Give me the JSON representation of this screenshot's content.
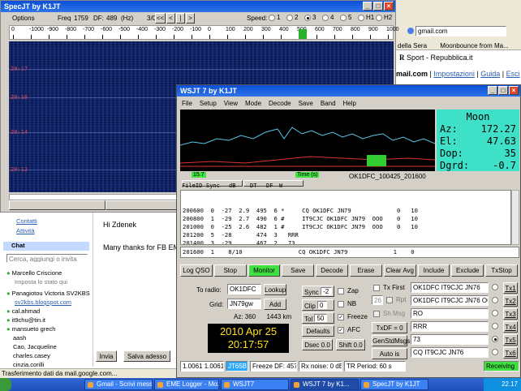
{
  "browser": {
    "toolbar_right": "gmail.com",
    "bookmarks": [
      "della Sera",
      "Moonbounce from Ma...",
      "Sport - Repubblica.it"
    ],
    "gmail_links": [
      "mail.com",
      "Impostazioni",
      "Guida",
      "Esci"
    ],
    "sidebar": {
      "contacts": "Contatti",
      "activity": "Attività",
      "chat_header": "Chat",
      "search_placeholder": "Cerca, aggiungi o invita",
      "contacts_list": [
        {
          "name": "Marcello Criscione",
          "status": "Imposta lo stato qui"
        },
        {
          "name": "Panagiotou Victoria SV2KBS",
          "status": "sv2kbs.blogspot.com"
        },
        {
          "name": "cal.ahmad"
        },
        {
          "name": "it9chu@tin.it"
        },
        {
          "name": "mansueto grech"
        },
        {
          "name": "aash"
        },
        {
          "name": "Cao, Jacqueline"
        },
        {
          "name": "charles.casey"
        },
        {
          "name": "cinzia.corilli"
        }
      ]
    },
    "mail": {
      "greeting": "Hi Zdenek",
      "body": "Many thanks for FB EME QSO",
      "send": "Invia",
      "save": "Salva adesso"
    },
    "status": "Trasferimento dati da mail.google.com..."
  },
  "specjt": {
    "title": "SpecJT    by K1JT",
    "options": "Options",
    "freq_label": "Freq",
    "freq": "1759",
    "df_label": "DF:",
    "df": "489",
    "hz": "(Hz)",
    "mode": "3/0",
    "nav": [
      "<<",
      "<",
      "|",
      ">"
    ],
    "speed_label": "Speed:",
    "speeds": [
      "1",
      "2",
      "3",
      "4",
      "5",
      "H1",
      "H2"
    ],
    "speed_selected": 2,
    "scale": [
      "0",
      "-1000",
      "-900",
      "-800",
      "-700",
      "-600",
      "-500",
      "-400",
      "-300",
      "-200",
      "-100",
      "0",
      "100",
      "200",
      "300",
      "400",
      "500",
      "600",
      "700",
      "800",
      "900",
      "1000"
    ],
    "times": [
      "20:17",
      "20:16",
      "20:14",
      "20:12"
    ]
  },
  "wsjt": {
    "title": "WSJT 7    by K1JT",
    "menu": [
      "File",
      "Setup",
      "View",
      "Mode",
      "Decode",
      "Save",
      "Band",
      "Help"
    ],
    "moon": {
      "title": "Moon",
      "az_label": "Az:",
      "az": "172.27",
      "el_label": "El:",
      "el": "47.63",
      "dop_label": "Dop:",
      "dop": "35",
      "dgrd_label": "Dgrd:",
      "dgrd": "-0.7"
    },
    "plot_left_label": "15.7",
    "plot_mid_label": "Time (s)",
    "file_id": "OK1DFC_100425_201600",
    "columns": [
      "FileID",
      "Sync",
      "dB",
      "DT",
      "DF",
      "W"
    ],
    "decodes": [
      "200600  0  -27  2.9  495  6 *     CQ OK1DFC JN79             0   10",
      "200800  1  -29  2.7  490  6 #     IT9CJC OK1DFC JN79  OOO    0   10",
      "201000  0  -25  2.6  482  1 #     IT9CJC OK1DFC JN79  OOO    0   10",
      "201200  5  -28       474  3   RRR",
      "201400  3  -29       467  2   73",
      "201600  0  -28  2.9  460  5 *     CQ OK1DFC JN79             0   10"
    ],
    "avg_line": "201600  1    8/10                CQ OK1DFC JN79             1    0",
    "buttons": [
      "Log QSO",
      "Stop",
      "Monitor",
      "Save",
      "Decode",
      "Erase",
      "Clear Avg",
      "Include",
      "Exclude",
      "TxStop"
    ],
    "to_radio_label": "To radio:",
    "to_radio": "OK1DFC",
    "lookup": "Lookup",
    "grid_label": "Grid:",
    "grid": "JN79gw",
    "add": "Add",
    "az_dist": "Az: 360      1443 km",
    "date": "2010 Apr 25",
    "clock": "20:17:57",
    "sync_label": "Sync",
    "sync": "-2",
    "clip_label": "Clip",
    "clip": "0",
    "tol_label": "Tol",
    "tol": "50",
    "defaults": "Defaults",
    "dsec": "Dsec  0.0",
    "shift": "Shift 0.0",
    "zap": "Zap",
    "nb": "NB",
    "freeze": "Freeze",
    "afc": "AFC",
    "tx_first": "Tx First",
    "gen_num": "26",
    "rpt": "Rpt",
    "sh_msg": "Sh Msg",
    "txdf": "TxDF = 0",
    "gen_std": "GenStdMsgs",
    "auto": "Auto is OFF",
    "tx_msgs": [
      "OK1DFC IT9CJC JN76",
      "OK1DFC IT9CJC JN76 OOO",
      "RO",
      "RRR",
      "73",
      "CQ IT9CJC JN76"
    ],
    "tx_labels": [
      "Tx1",
      "Tx2",
      "Tx3",
      "Tx4",
      "Tx5",
      "Tx6"
    ],
    "tx_selected": 4,
    "status": [
      "1.0061 1.0061",
      "JT65B",
      "Freeze DF: 457",
      "Rx noise: 0 dB",
      "TR Period: 60 s",
      "Receiving"
    ],
    "colors": {
      "accent_green": "#3fe03f",
      "moon_bg": "#3fe0c8"
    }
  },
  "taskbar": [
    {
      "label": "Gmail - Scrivi mess..."
    },
    {
      "label": "EME Logger - Mozill..."
    },
    {
      "label": "WSJT7"
    },
    {
      "label": "WSJT 7   by K1..."
    },
    {
      "label": "SpecJT   by K1JT"
    }
  ],
  "clock": "22.17"
}
